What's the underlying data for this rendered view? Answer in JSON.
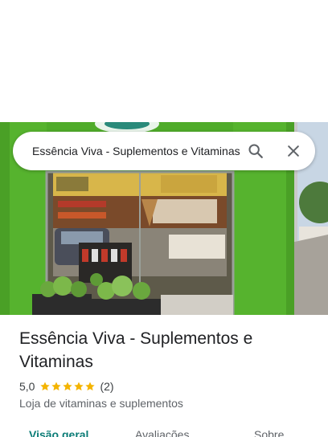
{
  "search": {
    "query": "Essência Viva - Suplementos e Vitaminas"
  },
  "icons": {
    "search": "search-icon",
    "close": "close-icon",
    "star": "star-icon"
  },
  "place": {
    "photo_alt": "storefront-photo",
    "name": "Essência Viva - Suplementos e Vitaminas",
    "rating": "5,0",
    "stars_filled": 5,
    "stars_total": 5,
    "review_count": "(2)",
    "category": "Loja de vitaminas e suplementos"
  },
  "tabs": [
    {
      "label": "Visão geral",
      "selected": true
    },
    {
      "label": "Avaliações",
      "selected": false
    },
    {
      "label": "Sobre",
      "selected": false
    }
  ],
  "colors": {
    "star": "#f4b400",
    "accent": "#0b7c76",
    "storefront_green": "#56b32e"
  }
}
